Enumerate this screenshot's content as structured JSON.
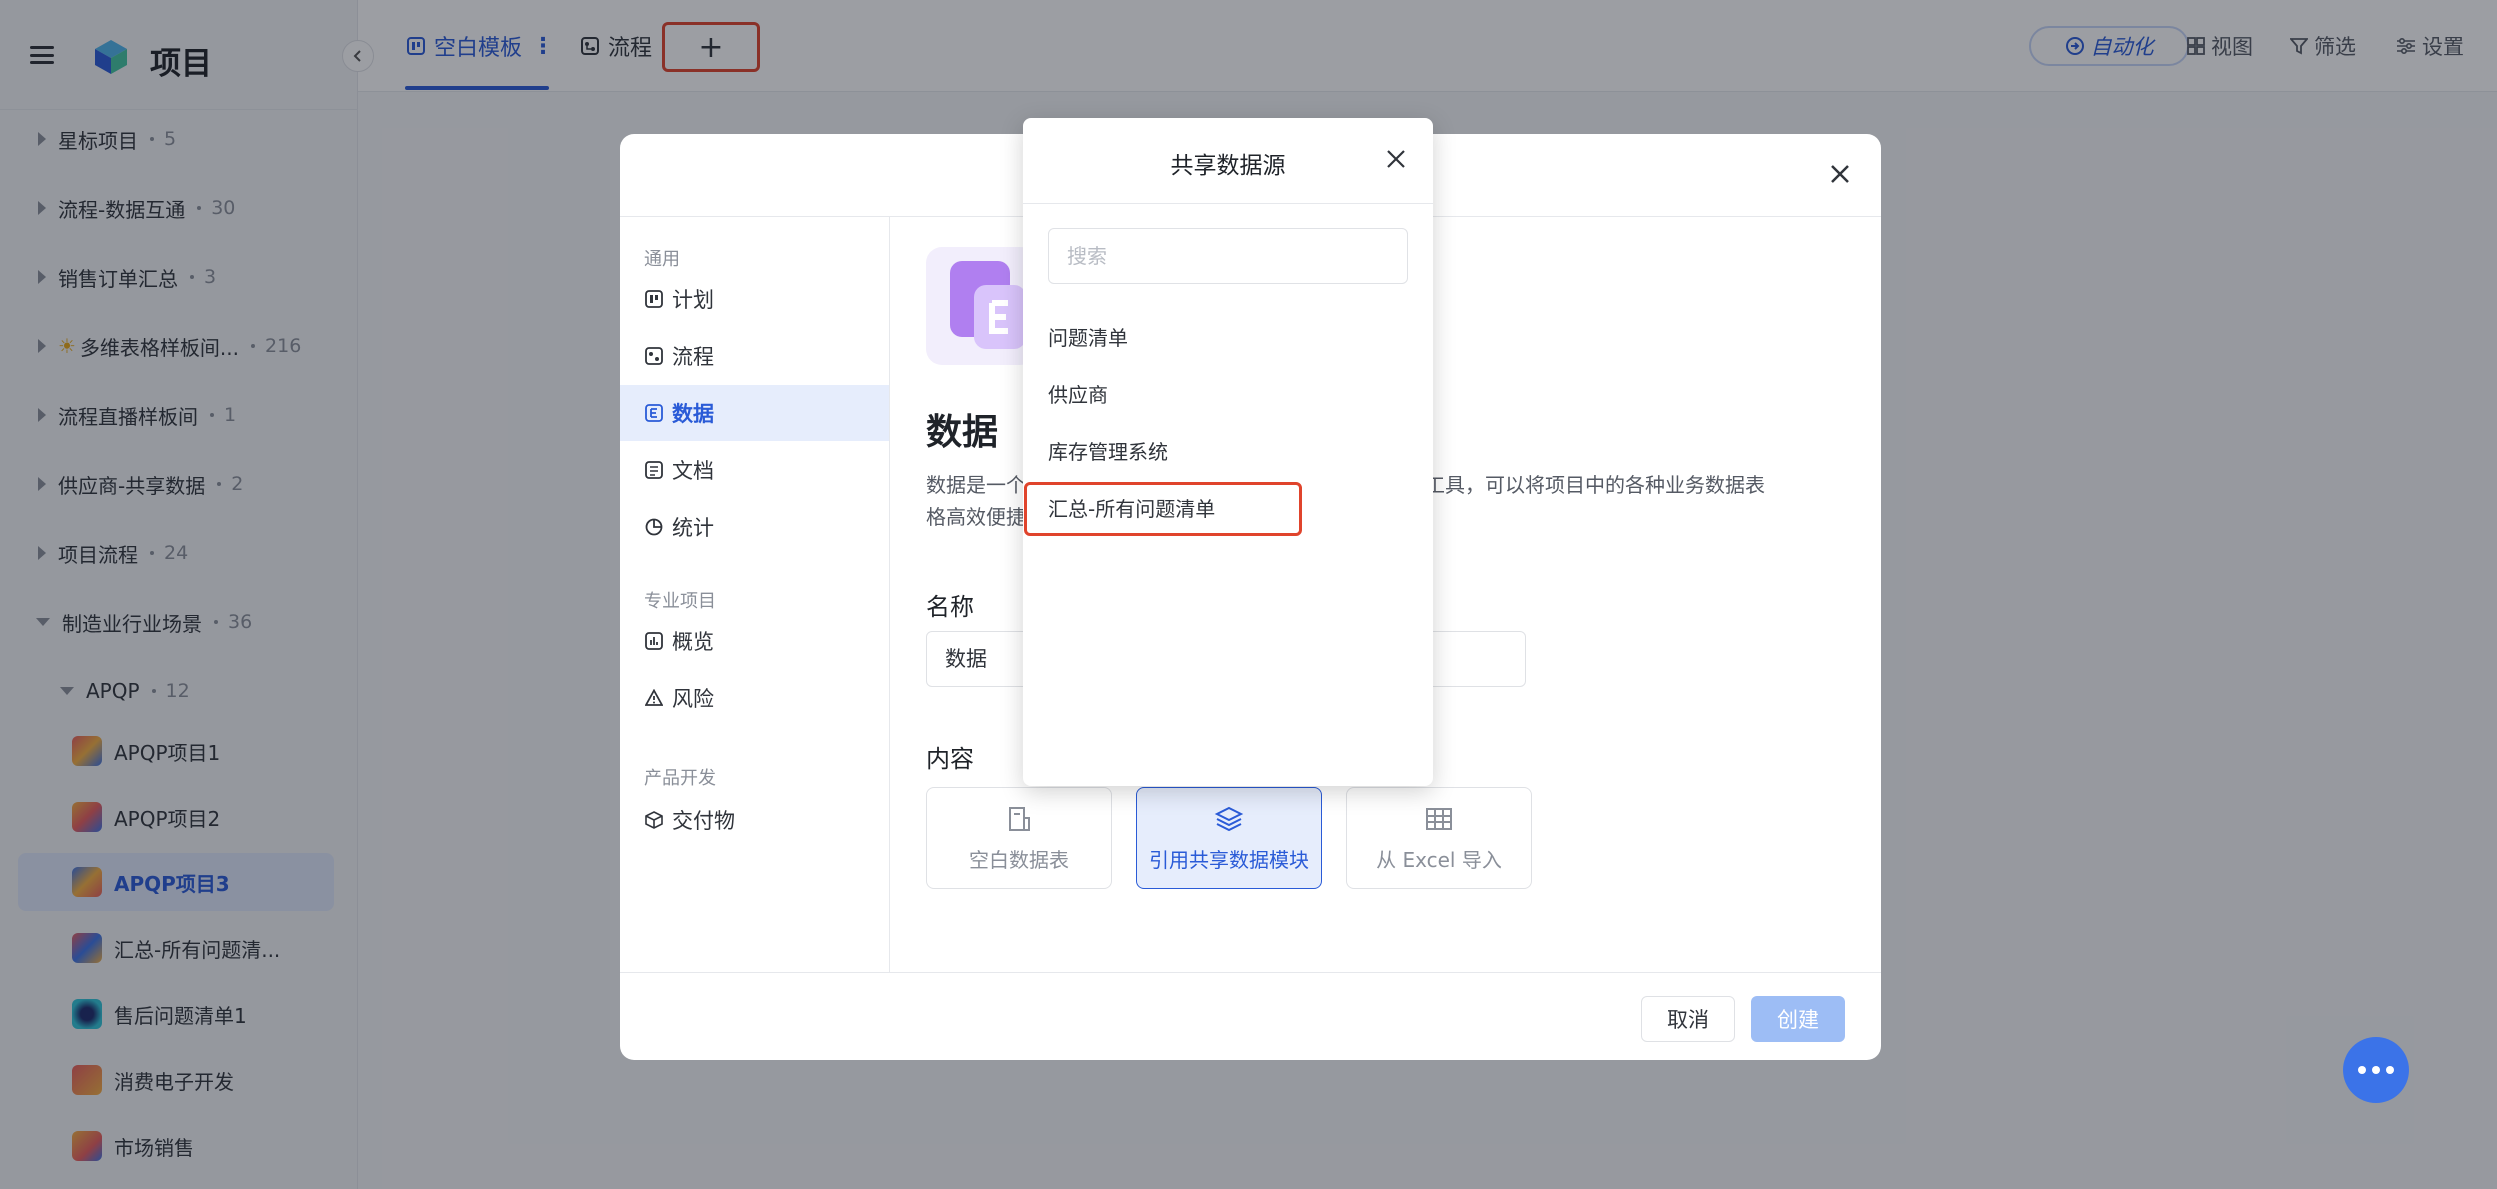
{
  "sidebar": {
    "title": "项目",
    "items": [
      {
        "label": "星标项目",
        "count": "5"
      },
      {
        "label": "流程-数据互通",
        "count": "30"
      },
      {
        "label": "销售订单汇总",
        "count": "3"
      },
      {
        "label": "多维表格样板间...",
        "count": "216"
      },
      {
        "label": "流程直播样板间",
        "count": "1"
      },
      {
        "label": "供应商-共享数据",
        "count": "2"
      },
      {
        "label": "项目流程",
        "count": "24"
      },
      {
        "label": "制造业行业场景",
        "count": "36"
      }
    ],
    "group": {
      "label": "APQP",
      "count": "12"
    },
    "sub_items": [
      {
        "label": "APQP项目1"
      },
      {
        "label": "APQP项目2"
      },
      {
        "label": "APQP项目3"
      },
      {
        "label": "汇总-所有问题清..."
      },
      {
        "label": "售后问题清单1"
      },
      {
        "label": "消费电子开发"
      },
      {
        "label": "市场销售"
      }
    ]
  },
  "topbar": {
    "tab1": "空白模板",
    "tab2": "流程",
    "add": "+",
    "automation": "自动化",
    "view": "视图",
    "filter": "筛选",
    "settings": "设置"
  },
  "modal": {
    "nav": {
      "group_general": "通用",
      "plan": "计划",
      "flow": "流程",
      "data": "数据",
      "doc": "文档",
      "stats": "统计",
      "group_pro": "专业项目",
      "overview": "概览",
      "risk": "风险",
      "group_dev": "产品开发",
      "deliverable": "交付物"
    },
    "title": "数据",
    "desc_line1_start": "数据是一个",
    "desc_line1_end": "表格工具，可以将项目中的各种业务数据表",
    "desc_line2_start": "格高效便捷",
    "name_label": "名称",
    "name_value": "数据",
    "content_label": "内容",
    "options": {
      "blank": "空白数据表",
      "shared": "引用共享数据模块",
      "excel": "从 Excel 导入"
    },
    "cancel": "取消",
    "create": "创建"
  },
  "popover": {
    "title": "共享数据源",
    "search_placeholder": "搜索",
    "items": [
      "问题清单",
      "供应商",
      "库存管理系统",
      "汇总-所有问题清单"
    ]
  },
  "colors": {
    "accent": "#2a5bd7",
    "highlight": "#e0442c"
  }
}
